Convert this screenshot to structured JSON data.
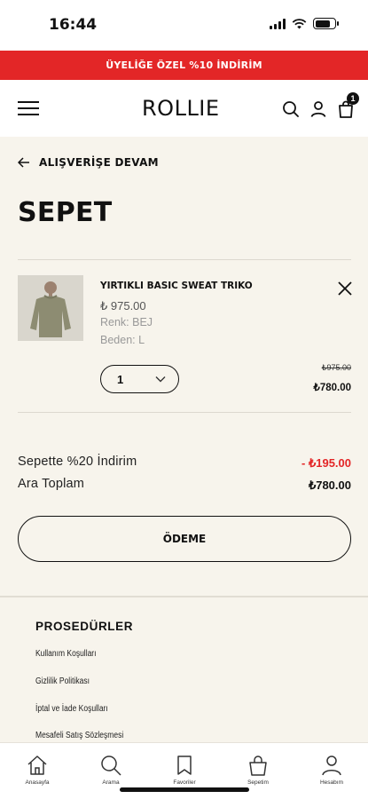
{
  "status_bar": {
    "time": "16:44"
  },
  "promo_banner": {
    "text": "ÜYELİĞE ÖZEL %10 İNDİRİM",
    "color": "#e32627"
  },
  "header": {
    "logo": "ROLLIE",
    "menu_icon": "hamburger-icon",
    "search_icon": "search-icon",
    "account_icon": "user-icon",
    "cart_icon": "shopping-bag-icon",
    "cart_count": "1"
  },
  "cart": {
    "back_label": "ALIŞVERİŞE DEVAM",
    "title": "SEPET",
    "item": {
      "name": "YIRTIKLI BASIC SWEAT TRIKO",
      "price": "₺ 975.00",
      "color": "Renk: BEJ",
      "size": "Beden: L",
      "quantity": "1",
      "old_price": "₺975.00",
      "new_price": "₺780.00"
    },
    "summary": {
      "discount_label": "Sepette %20 İndirim",
      "discount_value": "- ₺195.00",
      "subtotal_label": "Ara Toplam",
      "subtotal_value": "₺780.00"
    },
    "checkout_label": "ÖDEME"
  },
  "footer": {
    "heading": "PROSEDÜRLER",
    "links": [
      "Kullanım Koşulları",
      "Gizlilik Politikası",
      "İptal ve İade Koşulları",
      "Mesafeli Satış Sözleşmesi"
    ]
  },
  "bottom_nav": {
    "items": [
      {
        "label": "Anasayfa",
        "icon": "home-icon"
      },
      {
        "label": "Arama",
        "icon": "search-icon"
      },
      {
        "label": "Favoriler",
        "icon": "bookmark-icon"
      },
      {
        "label": "Sepetim",
        "icon": "shopping-bag-icon"
      },
      {
        "label": "Hesabım",
        "icon": "user-icon"
      }
    ]
  }
}
